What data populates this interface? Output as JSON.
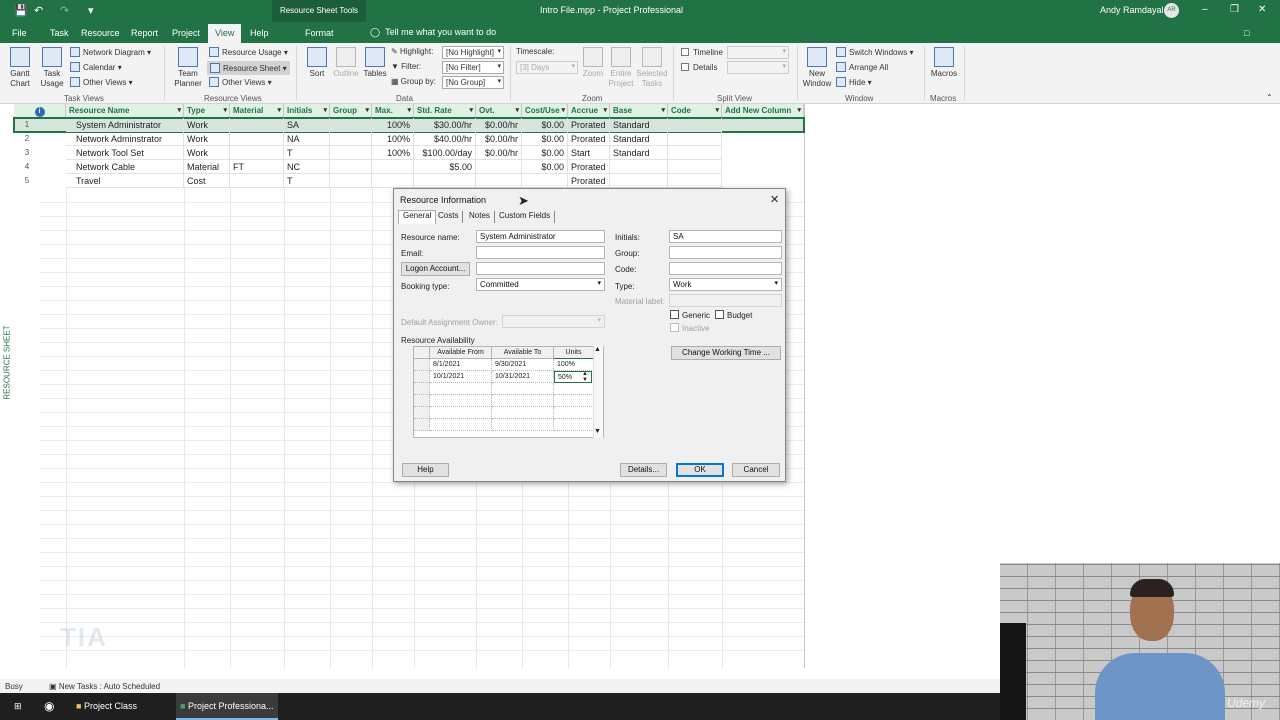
{
  "titlebar": {
    "context_tab": "Resource Sheet Tools",
    "document_title": "Intro File.mpp  -  Project Professional",
    "user_name": "Andy Ramdayal",
    "user_initials": "AR"
  },
  "tabs": [
    "File",
    "Task",
    "Resource",
    "Report",
    "Project",
    "View",
    "Help",
    "Format"
  ],
  "active_tab": "View",
  "tell_me": "Tell me what you want to do",
  "ribbon": {
    "task_views": {
      "label": "Task Views",
      "gantt": "Gantt\nChart",
      "task_usage": "Task\nUsage",
      "network_diagram": "Network Diagram",
      "calendar": "Calendar",
      "other_views": "Other Views"
    },
    "resource_views": {
      "label": "Resource Views",
      "team_planner": "Team\nPlanner",
      "resource_usage": "Resource Usage",
      "resource_sheet": "Resource Sheet",
      "other_views": "Other Views"
    },
    "data": {
      "label": "Data",
      "sort": "Sort",
      "outline": "Outline",
      "tables": "Tables",
      "highlight_label": "Highlight:",
      "highlight_value": "[No Highlight]",
      "filter_label": "Filter:",
      "filter_value": "[No Filter]",
      "groupby_label": "Group by:",
      "groupby_value": "[No Group]"
    },
    "zoom": {
      "label": "Zoom",
      "timescale_label": "Timescale:",
      "timescale_value": "[3] Days",
      "zoom": "Zoom",
      "entire_project": "Entire\nProject",
      "selected_tasks": "Selected\nTasks"
    },
    "split_view": {
      "label": "Split View",
      "timeline": "Timeline",
      "details": "Details"
    },
    "window": {
      "label": "Window",
      "new_window": "New\nWindow",
      "switch_windows": "Switch Windows",
      "arrange_all": "Arrange All",
      "hide": "Hide"
    },
    "macros": {
      "label": "Macros",
      "macros": "Macros"
    }
  },
  "sheet": {
    "sidebar_label": "RESOURCE SHEET",
    "columns": [
      "Resource Name",
      "Type",
      "Material",
      "Initials",
      "Group",
      "Max.",
      "Std. Rate",
      "Ovt.",
      "Cost/Use",
      "Accrue",
      "Base",
      "Code",
      "Add New Column"
    ],
    "rows": [
      {
        "id": "1",
        "name": "System Administrator",
        "type": "Work",
        "material": "",
        "initials": "SA",
        "group": "",
        "max": "100%",
        "std_rate": "$30.00/hr",
        "ovt": "$0.00/hr",
        "cost_use": "$0.00",
        "accrue": "Prorated",
        "base": "Standard",
        "code": ""
      },
      {
        "id": "2",
        "name": "Network Adminstrator",
        "type": "Work",
        "material": "",
        "initials": "NA",
        "group": "",
        "max": "100%",
        "std_rate": "$40.00/hr",
        "ovt": "$0.00/hr",
        "cost_use": "$0.00",
        "accrue": "Prorated",
        "base": "Standard",
        "code": ""
      },
      {
        "id": "3",
        "name": "Network Tool Set",
        "type": "Work",
        "material": "",
        "initials": "T",
        "group": "",
        "max": "100%",
        "std_rate": "$100.00/day",
        "ovt": "$0.00/hr",
        "cost_use": "$0.00",
        "accrue": "Start",
        "base": "Standard",
        "code": ""
      },
      {
        "id": "4",
        "name": "Network Cable",
        "type": "Material",
        "material": "FT",
        "initials": "NC",
        "group": "",
        "max": "",
        "std_rate": "$5.00",
        "ovt": "",
        "cost_use": "$0.00",
        "accrue": "Prorated",
        "base": "",
        "code": ""
      },
      {
        "id": "5",
        "name": "Travel",
        "type": "Cost",
        "material": "",
        "initials": "T",
        "group": "",
        "max": "",
        "std_rate": "",
        "ovt": "",
        "cost_use": "",
        "accrue": "Prorated",
        "base": "",
        "code": ""
      }
    ]
  },
  "dialog": {
    "title": "Resource Information",
    "tabs": [
      "General",
      "Costs",
      "Notes",
      "Custom Fields"
    ],
    "active_tab": "General",
    "resource_name_label": "Resource name:",
    "resource_name_value": "System Administrator",
    "email_label": "Email:",
    "email_value": "",
    "logon_button": "Logon Account...",
    "booking_type_label": "Booking type:",
    "booking_type_value": "Committed",
    "default_owner_label": "Default Assignment Owner:",
    "initials_label": "Initials:",
    "initials_value": "SA",
    "group_label": "Group:",
    "group_value": "",
    "code_label": "Code:",
    "code_value": "",
    "type_label": "Type:",
    "type_value": "Work",
    "material_label": "Material label:",
    "generic_label": "Generic",
    "budget_label": "Budget",
    "inactive_label": "Inactive",
    "change_working_time": "Change Working Time ...",
    "availability_label": "Resource Availability",
    "availability_columns": [
      "Available From",
      "Available To",
      "Units"
    ],
    "availability_rows": [
      {
        "from": "8/1/2021",
        "to": "9/30/2021",
        "units": "100%"
      },
      {
        "from": "10/1/2021",
        "to": "10/31/2021",
        "units": "50%"
      }
    ],
    "help_button": "Help",
    "details_button": "Details...",
    "ok_button": "OK",
    "cancel_button": "Cancel"
  },
  "statusbar": {
    "state": "Busy",
    "new_tasks": "New Tasks : Auto Scheduled"
  },
  "taskbar": {
    "items": [
      "Project Class",
      "Project Professiona..."
    ]
  },
  "webcam": {
    "logo": "Udemy"
  },
  "colors": {
    "brand_green": "#217346",
    "header_fill": "#dff0e4",
    "selection": "#0078d7"
  }
}
